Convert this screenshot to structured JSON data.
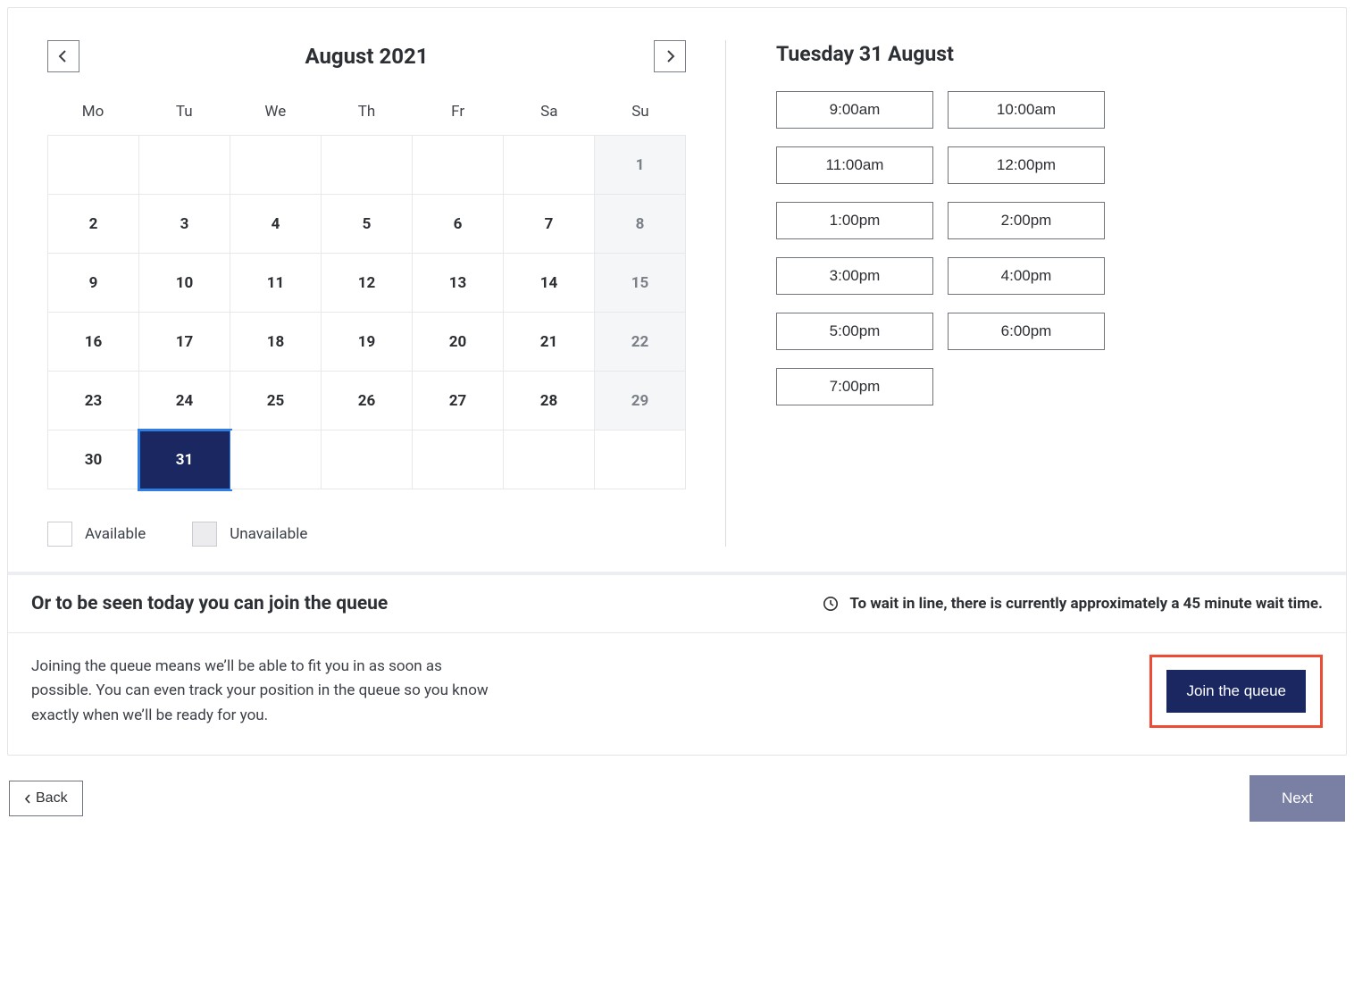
{
  "calendar": {
    "title": "August 2021",
    "dow": [
      "Mo",
      "Tu",
      "We",
      "Th",
      "Fr",
      "Sa",
      "Su"
    ],
    "selected_day": 31,
    "rows": [
      [
        null,
        null,
        null,
        null,
        null,
        null,
        {
          "d": 1,
          "unavail": true
        }
      ],
      [
        {
          "d": 2
        },
        {
          "d": 3
        },
        {
          "d": 4
        },
        {
          "d": 5
        },
        {
          "d": 6
        },
        {
          "d": 7
        },
        {
          "d": 8,
          "unavail": true
        }
      ],
      [
        {
          "d": 9
        },
        {
          "d": 10
        },
        {
          "d": 11
        },
        {
          "d": 12
        },
        {
          "d": 13
        },
        {
          "d": 14
        },
        {
          "d": 15,
          "unavail": true
        }
      ],
      [
        {
          "d": 16
        },
        {
          "d": 17
        },
        {
          "d": 18
        },
        {
          "d": 19
        },
        {
          "d": 20
        },
        {
          "d": 21
        },
        {
          "d": 22,
          "unavail": true
        }
      ],
      [
        {
          "d": 23
        },
        {
          "d": 24
        },
        {
          "d": 25
        },
        {
          "d": 26
        },
        {
          "d": 27
        },
        {
          "d": 28
        },
        {
          "d": 29,
          "unavail": true
        }
      ],
      [
        {
          "d": 30
        },
        {
          "d": 31,
          "selected": true
        },
        null,
        null,
        null,
        null,
        null
      ]
    ],
    "legend": {
      "available": "Available",
      "unavailable": "Unavailable"
    }
  },
  "timeslots": {
    "title": "Tuesday 31 August",
    "slots": [
      "9:00am",
      "10:00am",
      "11:00am",
      "12:00pm",
      "1:00pm",
      "2:00pm",
      "3:00pm",
      "4:00pm",
      "5:00pm",
      "6:00pm",
      "7:00pm"
    ]
  },
  "queue": {
    "heading": "Or to be seen today you can join the queue",
    "wait_text": "To wait in line, there is currently approximately a 45 minute wait time.",
    "description": "Joining the queue means we’ll be able to fit you in as soon as possible. You can even track your position in the queue so you know exactly when we’ll be ready for you.",
    "join_label": "Join the queue"
  },
  "footer": {
    "back_label": "Back",
    "next_label": "Next"
  }
}
